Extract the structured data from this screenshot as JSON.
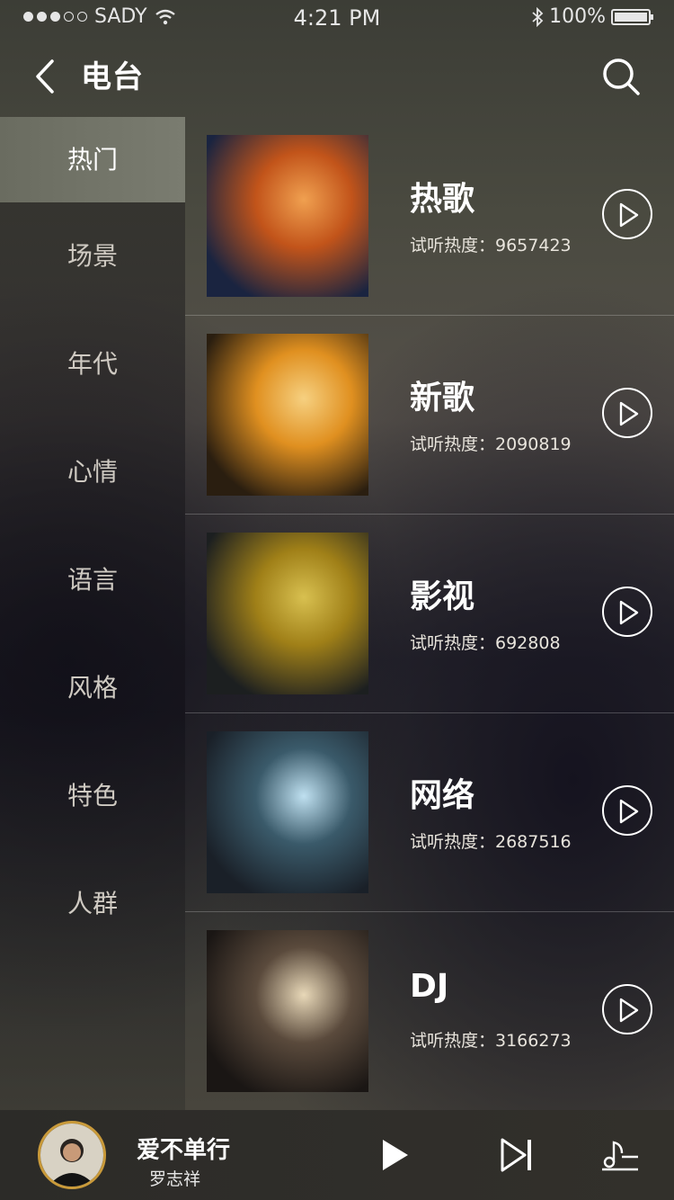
{
  "status_bar": {
    "carrier": "SADY",
    "time": "4:21 PM",
    "battery": "100%"
  },
  "nav": {
    "title": "电台"
  },
  "sidebar": {
    "items": [
      {
        "label": "热门",
        "active": true
      },
      {
        "label": "场景"
      },
      {
        "label": "年代"
      },
      {
        "label": "心情"
      },
      {
        "label": "语言"
      },
      {
        "label": "风格"
      },
      {
        "label": "特色"
      },
      {
        "label": "人群"
      }
    ]
  },
  "stations": [
    {
      "title": "热歌",
      "plays": "试听热度：9657423",
      "thumb_colors": [
        "#1a2440",
        "#c2541a",
        "#f0a050"
      ]
    },
    {
      "title": "新歌",
      "plays": "试听热度：2090819",
      "thumb_colors": [
        "#2a1e10",
        "#e09020",
        "#f6d080"
      ]
    },
    {
      "title": "影视",
      "plays": "试听热度：692808",
      "thumb_colors": [
        "#1c1f20",
        "#a08018",
        "#d8c050"
      ]
    },
    {
      "title": "网络",
      "plays": "试听热度：2687516",
      "thumb_colors": [
        "#1a2028",
        "#3a5a6a",
        "#bfe0f0"
      ]
    },
    {
      "title": "DJ",
      "plays": "试听热度：3166273",
      "thumb_colors": [
        "#1a1614",
        "#5a4a3c",
        "#e8d8b8"
      ]
    }
  ],
  "player": {
    "song": "爱不单行",
    "artist": "罗志祥"
  },
  "colors": {
    "active_tab": "#72746a",
    "avatar_ring": "#c99a3a"
  }
}
